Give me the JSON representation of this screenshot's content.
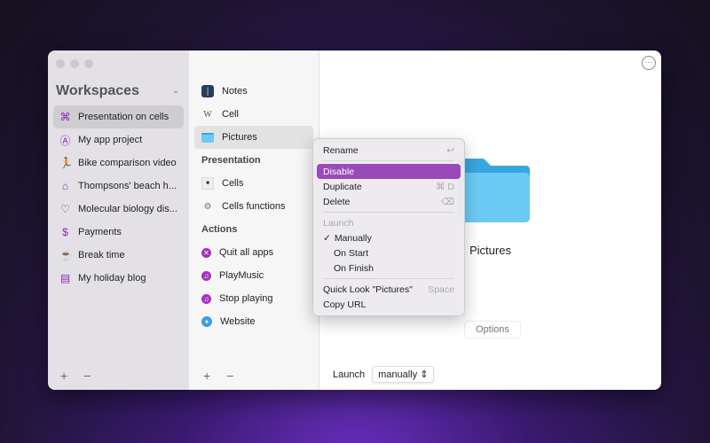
{
  "sidebar": {
    "title": "Workspaces",
    "items": [
      {
        "label": "Presentation on cells",
        "icon": "network-icon",
        "glyph": "⌘"
      },
      {
        "label": "My app project",
        "icon": "app-a-icon",
        "glyph": "Ⓐ"
      },
      {
        "label": "Bike comparison video",
        "icon": "runner-icon",
        "glyph": "🏃"
      },
      {
        "label": "Thompsons' beach h...",
        "icon": "house-icon",
        "glyph": "⌂"
      },
      {
        "label": "Molecular biology dis...",
        "icon": "heart-pulse-icon",
        "glyph": "♡"
      },
      {
        "label": "Payments",
        "icon": "dollar-icon",
        "glyph": "$"
      },
      {
        "label": "Break time",
        "icon": "coffee-icon",
        "glyph": "☕"
      },
      {
        "label": "My holiday blog",
        "icon": "newspaper-icon",
        "glyph": "▤"
      }
    ],
    "add": "+",
    "remove": "−"
  },
  "middle": {
    "items": [
      {
        "label": "Notes"
      },
      {
        "label": "Cell"
      },
      {
        "label": "Pictures"
      }
    ],
    "presentation_header": "Presentation",
    "presentation": [
      {
        "label": "Cells"
      },
      {
        "label": "Cells functions"
      }
    ],
    "actions_header": "Actions",
    "actions": [
      {
        "label": "Quit all apps"
      },
      {
        "label": "PlayMusic"
      },
      {
        "label": "Stop playing"
      },
      {
        "label": "Website"
      }
    ],
    "add": "+",
    "remove": "−"
  },
  "main": {
    "title": "Pictures",
    "options": "Options",
    "launch_label": "Launch",
    "launch_value": "manually",
    "more": "···"
  },
  "menu": {
    "rename": "Rename",
    "rename_key": "↩",
    "disable": "Disable",
    "duplicate": "Duplicate",
    "duplicate_key": "⌘ D",
    "delete": "Delete",
    "delete_key": "⌫",
    "launch": "Launch",
    "check": "✓",
    "manually": "Manually",
    "on_start": "On Start",
    "on_finish": "On Finish",
    "quick_look": "Quick Look \"Pictures\"",
    "quick_look_key": "Space",
    "copy_url": "Copy URL"
  },
  "colors": {
    "accent": "#9a4ab8",
    "folder": "#6ccbf5"
  }
}
